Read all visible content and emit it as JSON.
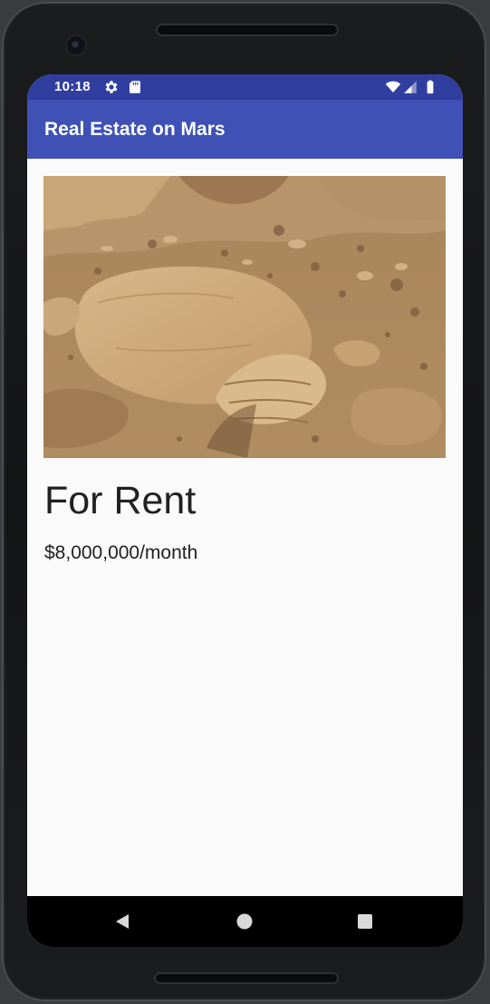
{
  "status_bar": {
    "time": "10:18",
    "background": "#303f9f",
    "icons": [
      "settings-gear-icon",
      "sd-card-icon",
      "wifi-icon",
      "cell-signal-icon",
      "battery-icon"
    ]
  },
  "app_bar": {
    "title": "Real Estate on Mars",
    "background": "#3f51b5"
  },
  "listing": {
    "image_subject": "mars-surface-photo",
    "type_label": "For Rent",
    "price_label": "$8,000,000/month"
  },
  "navigation_bar": {
    "buttons": [
      "back-icon",
      "home-icon",
      "recents-icon"
    ]
  }
}
